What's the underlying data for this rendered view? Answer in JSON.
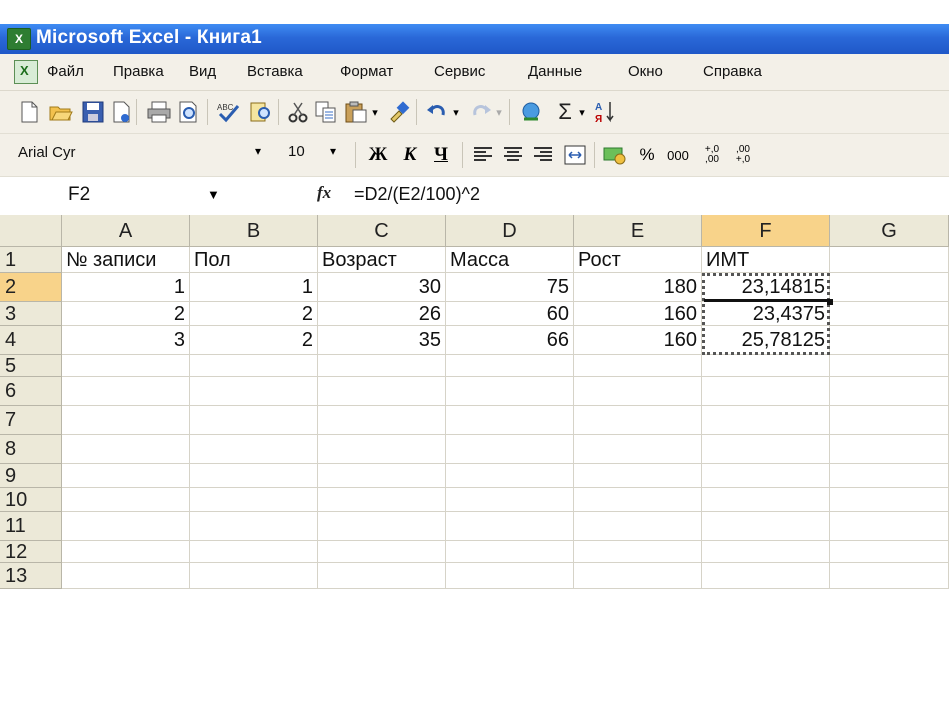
{
  "window": {
    "title": "Microsoft Excel - Книга1",
    "icon": "excel-app-icon"
  },
  "menu": [
    {
      "label": "Файл"
    },
    {
      "label": "Правка"
    },
    {
      "label": "Вид"
    },
    {
      "label": "Вставка"
    },
    {
      "label": "Формат"
    },
    {
      "label": "Сервис"
    },
    {
      "label": "Данные"
    },
    {
      "label": "Окно"
    },
    {
      "label": "Справка"
    }
  ],
  "toolbar": {
    "icons": [
      "new-icon",
      "open-icon",
      "save-icon",
      "permission-icon",
      "print-icon",
      "print-preview-icon",
      "spelling-icon",
      "research-icon",
      "cut-icon",
      "copy-icon",
      "paste-icon",
      "format-painter-icon",
      "undo-icon",
      "redo-icon",
      "hyperlink-icon",
      "autosum-icon",
      "sort-ascending-icon"
    ],
    "autosum_symbol": "Σ"
  },
  "formatting": {
    "font": "Arial Cyr",
    "size": "10",
    "bold": "Ж",
    "italic": "К",
    "underline": "Ч",
    "percent": "%",
    "thousands": "000",
    "inc_decimal": "+,0 ,00",
    "dec_decimal": ",00 +,0"
  },
  "formula_bar": {
    "name_box": "F2",
    "fx": "fx",
    "formula": "=D2/(E2/100)^2"
  },
  "sheet": {
    "columns": [
      "A",
      "B",
      "C",
      "D",
      "E",
      "F",
      "G"
    ],
    "active_column": "F",
    "rows": [
      "1",
      "2",
      "3",
      "4",
      "5",
      "6",
      "7",
      "8",
      "9",
      "10",
      "11",
      "12",
      "13"
    ],
    "active_row": "2",
    "cells": [
      [
        "№ записи",
        "Пол",
        "Возраст",
        "Масса",
        "Рост",
        "ИМТ",
        ""
      ],
      [
        "1",
        "1",
        "30",
        "75",
        "180",
        "23,14815",
        ""
      ],
      [
        "2",
        "2",
        "26",
        "60",
        "160",
        "23,4375",
        ""
      ],
      [
        "3",
        "2",
        "35",
        "66",
        "160",
        "25,78125",
        ""
      ]
    ]
  },
  "colors": {
    "title_bar": "#2a68d8",
    "toolbar_bg": "#f3f0e8",
    "header_bg": "#ece9d8",
    "active_header": "#f8d38a"
  }
}
